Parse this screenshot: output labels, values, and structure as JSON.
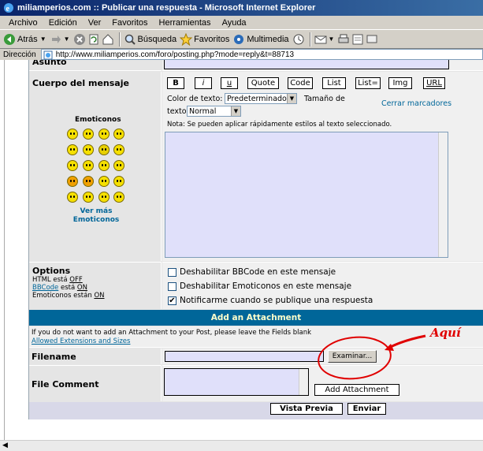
{
  "window": {
    "title": "miliamperios.com :: Publicar una respuesta - Microsoft Internet Explorer"
  },
  "menu": [
    "Archivo",
    "Edición",
    "Ver",
    "Favoritos",
    "Herramientas",
    "Ayuda"
  ],
  "toolbar": {
    "back": "Atrás",
    "search": "Búsqueda",
    "favorites": "Favoritos",
    "media": "Multimedia"
  },
  "address": {
    "label": "Dirección",
    "url": "http://www.miliamperios.com/foro/posting.php?mode=reply&t=88713"
  },
  "form": {
    "subject_label": "Asunto",
    "body_label": "Cuerpo del mensaje",
    "emoticons_title": "Emoticonos",
    "more_emoticons": "Ver más Emoticonos",
    "bbcode_buttons": [
      "B",
      "i",
      "u",
      "Quote",
      "Code",
      "List",
      "List=",
      "Img",
      "URL"
    ],
    "font_color_label": "Color de texto:",
    "font_color_value": "Predeterminado",
    "font_size_label_a": "Tamaño de",
    "font_size_label_b": "texto:",
    "font_size_value": "Normal",
    "close_tags": "Cerrar marcadores",
    "hint": "Nota: Se pueden aplicar rápidamente estilos al texto seleccionado.",
    "options_title": "Options",
    "opt_html": "HTML está",
    "opt_html_state": "OFF",
    "opt_bbcode_link": "BBCode",
    "opt_bbcode": "está",
    "opt_bbcode_state": "ON",
    "opt_emo": "Emoticonos están",
    "opt_emo_state": "ON",
    "check1": "Deshabilitar BBCode en este mensaje",
    "check2": "Deshabilitar Emoticonos en este mensaje",
    "check3": "Notificarme cuando se publique una respuesta",
    "attach_header": "Add an Attachment",
    "attach_note": "If you do not want to add an Attachment to your Post, please leave the Fields blank",
    "allowed_link": "Allowed Extensions and Sizes",
    "filename_label": "Filename",
    "browse_button": "Examinar...",
    "comment_label": "File Comment",
    "add_attachment": "Add Attachment",
    "preview": "Vista Previa",
    "submit": "Enviar"
  },
  "annotation": {
    "text": "Aquí",
    "color": "#e00000"
  },
  "colors": {
    "header_blue": "#006699",
    "field_bg": "#e0e0fa",
    "link": "#006699"
  }
}
